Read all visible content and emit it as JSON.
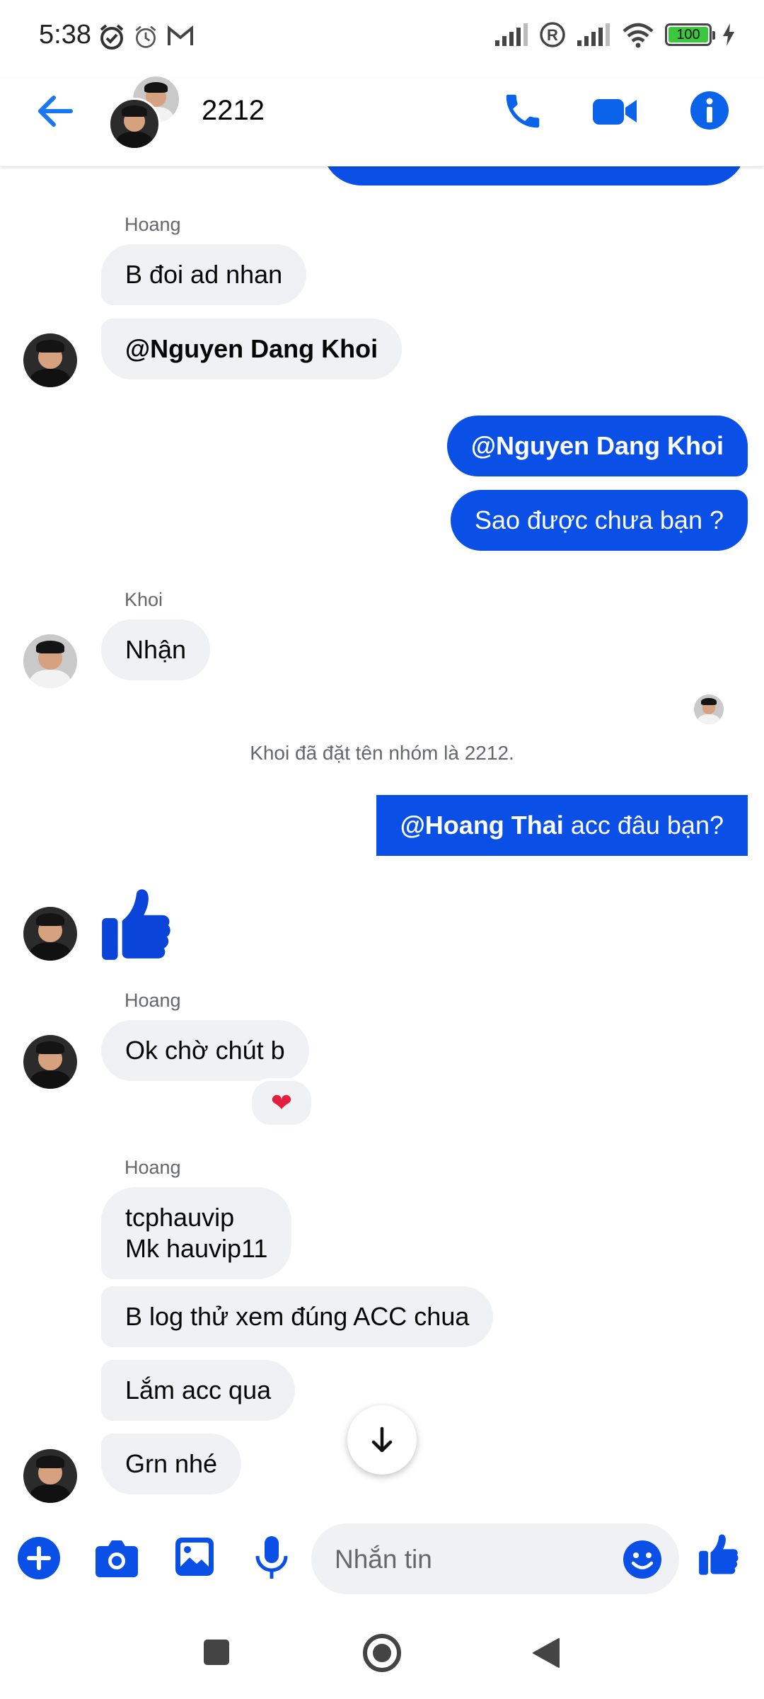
{
  "status_bar": {
    "time": "5:38",
    "battery": "100",
    "icons": [
      "alarm-clock-icon",
      "alarm-icon",
      "gmail-icon",
      "signal-icon",
      "registered-icon",
      "signal-icon",
      "wifi-icon",
      "battery-icon",
      "charging-icon"
    ]
  },
  "header": {
    "title": "2212",
    "back_icon": "arrow-left-icon",
    "call_icon": "phone-icon",
    "video_icon": "video-camera-icon",
    "info_icon": "info-icon"
  },
  "messages": [
    {
      "type": "incoming",
      "sender": "Hoang",
      "text": "B đoi ad nhan"
    },
    {
      "type": "incoming",
      "text": "@Nguyen Dang Khoi",
      "mention": true
    },
    {
      "type": "outgoing",
      "text": "@Nguyen Dang Khoi",
      "mention": true
    },
    {
      "type": "outgoing",
      "text": "Sao được chưa bạn ?"
    },
    {
      "type": "incoming",
      "sender": "Khoi",
      "text": "Nhận"
    },
    {
      "type": "system",
      "text": "Khoi đã đặt tên nhóm là 2212."
    },
    {
      "type": "outgoing",
      "mention_text": "@Hoang Thai",
      "text": " acc đâu bạn?"
    },
    {
      "type": "incoming",
      "sticker": "thumbs-up-icon"
    },
    {
      "type": "incoming",
      "sender": "Hoang",
      "text": "Ok chờ chút b",
      "reaction": "❤"
    },
    {
      "type": "incoming",
      "sender": "Hoang",
      "text": "tcphauvip\nMk hauvip11"
    },
    {
      "type": "incoming",
      "text": "B log thử xem đúng ACC chua"
    },
    {
      "type": "incoming",
      "text": "Lắm acc qua"
    },
    {
      "type": "incoming",
      "text": "Grn nhé"
    }
  ],
  "composer": {
    "placeholder": "Nhắn tin",
    "icons": [
      "plus-icon",
      "camera-icon",
      "image-icon",
      "microphone-icon",
      "emoji-icon",
      "thumbs-up-icon"
    ]
  },
  "colors": {
    "accent": "#0a50e6",
    "icon_blue": "#1877f2",
    "incoming_bg": "#eff1f4",
    "secondary_text": "#65676b"
  }
}
